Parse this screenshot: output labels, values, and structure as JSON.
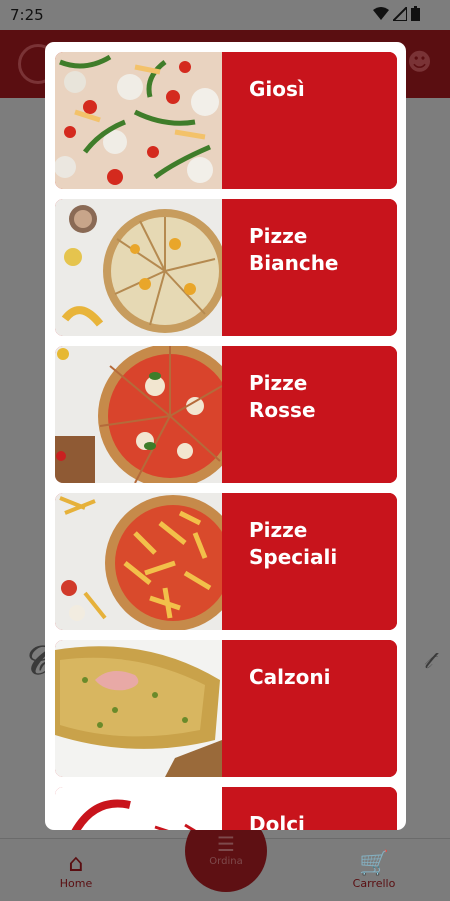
{
  "status_bar": {
    "time": "7:25"
  },
  "categories": [
    {
      "label": "Giosì"
    },
    {
      "label": "Pizze\nBianche"
    },
    {
      "label": "Pizze\nRosse"
    },
    {
      "label": "Pizze\nSpeciali"
    },
    {
      "label": "Calzoni"
    },
    {
      "label": "Dolci"
    }
  ],
  "bottom_nav": {
    "home_label": "Home",
    "order_label": "Ordina",
    "cart_label": "Carrello"
  },
  "colors": {
    "brand_red": "#c8141c",
    "overlay_dark_red": "#5a0e11"
  }
}
